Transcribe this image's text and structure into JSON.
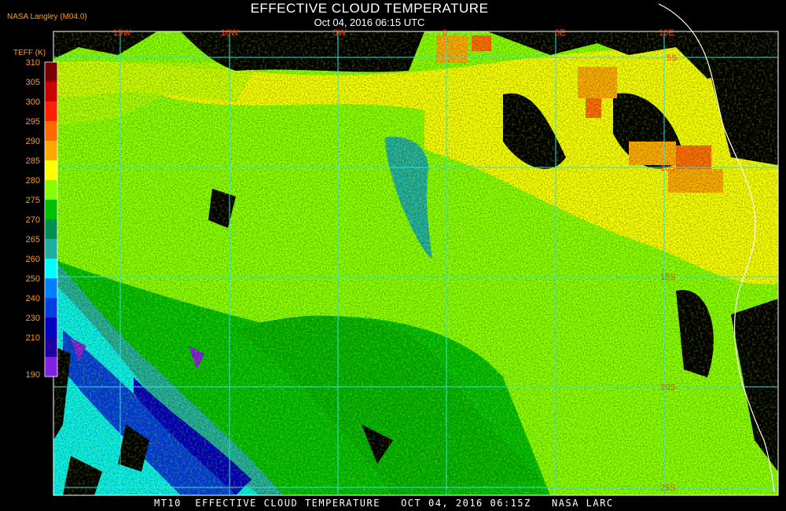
{
  "header": {
    "org_label": "NASA Langley (M04.0)",
    "title": "EFFECTIVE CLOUD TEMPERATURE",
    "subtitle": "Oct 04, 2016 06:15 UTC"
  },
  "footer": {
    "text": "MT10  EFFECTIVE CLOUD TEMPERATURE   OCT 04, 2016 06:15Z   NASA LARC"
  },
  "legend": {
    "title": "TEFF (K)",
    "entries": [
      {
        "label": "310",
        "color": "#7a0000"
      },
      {
        "label": "305",
        "color": "#c80000"
      },
      {
        "label": "300",
        "color": "#ff2000"
      },
      {
        "label": "295",
        "color": "#ff6a00"
      },
      {
        "label": "290",
        "color": "#ffaa00"
      },
      {
        "label": "285",
        "color": "#ffff00"
      },
      {
        "label": "280",
        "color": "#88ff00"
      },
      {
        "label": "275",
        "color": "#00c000"
      },
      {
        "label": "270",
        "color": "#009050"
      },
      {
        "label": "265",
        "color": "#20b0a0"
      },
      {
        "label": "260",
        "color": "#00ffff"
      },
      {
        "label": "250",
        "color": "#0080ff"
      },
      {
        "label": "240",
        "color": "#0040e0"
      },
      {
        "label": "230",
        "color": "#0000c0"
      },
      {
        "label": "210",
        "color": "#2000a0"
      },
      {
        "label": "190",
        "color": "#8020e0"
      }
    ]
  },
  "map": {
    "grid_color": "#30e0e0",
    "label_color": "#ff4000",
    "longitude_labels": [
      "15W",
      "10W",
      "5W",
      "0",
      "5E",
      "10E"
    ],
    "latitude_labels": [
      "5S",
      "10S",
      "15S",
      "20S",
      "25S"
    ]
  }
}
